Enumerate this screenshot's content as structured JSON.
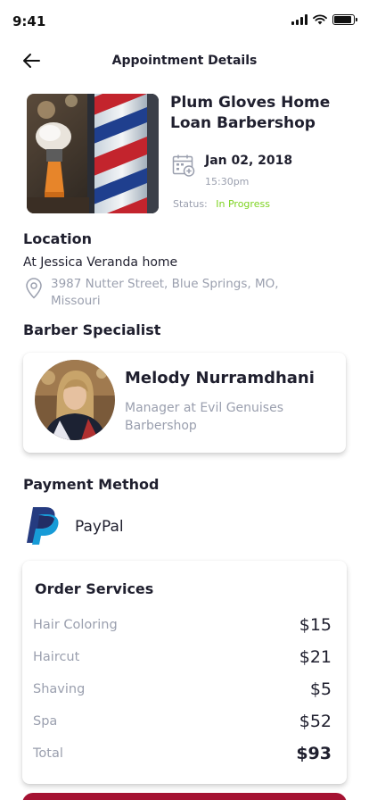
{
  "status_bar": {
    "time": "9:41",
    "battery_level": 0.9
  },
  "header": {
    "title": "Appointment Details",
    "back_icon": "arrow-left-icon"
  },
  "appointment": {
    "shop_name": "Plum Gloves Home Loan Barbershop",
    "date": "Jan 02, 2018",
    "time": "15:30pm",
    "status_label": "Status:",
    "status_value": "In Progress",
    "status_color": "#7ed321"
  },
  "location": {
    "title": "Location",
    "name": "At Jessica Veranda home",
    "address": "3987  Nutter Street, Blue Springs, MO, Missouri"
  },
  "specialist": {
    "title": "Barber Specialist",
    "name": "Melody Nurramdhani",
    "role": "Manager at Evil Genuises Barbershop"
  },
  "payment": {
    "title": "Payment Method",
    "method": "PayPal"
  },
  "order": {
    "title": "Order Services",
    "services": [
      {
        "name": "Hair Coloring",
        "price": "$15"
      },
      {
        "name": "Haircut",
        "price": "$21"
      },
      {
        "name": "Shaving",
        "price": "$5"
      },
      {
        "name": "Spa",
        "price": "$52"
      }
    ],
    "total_label": "Total",
    "total_value": "$93"
  },
  "colors": {
    "accent": "#a51232",
    "muted_text": "#9a9fae",
    "paypal_dark": "#253b80",
    "paypal_light": "#179bd7"
  }
}
